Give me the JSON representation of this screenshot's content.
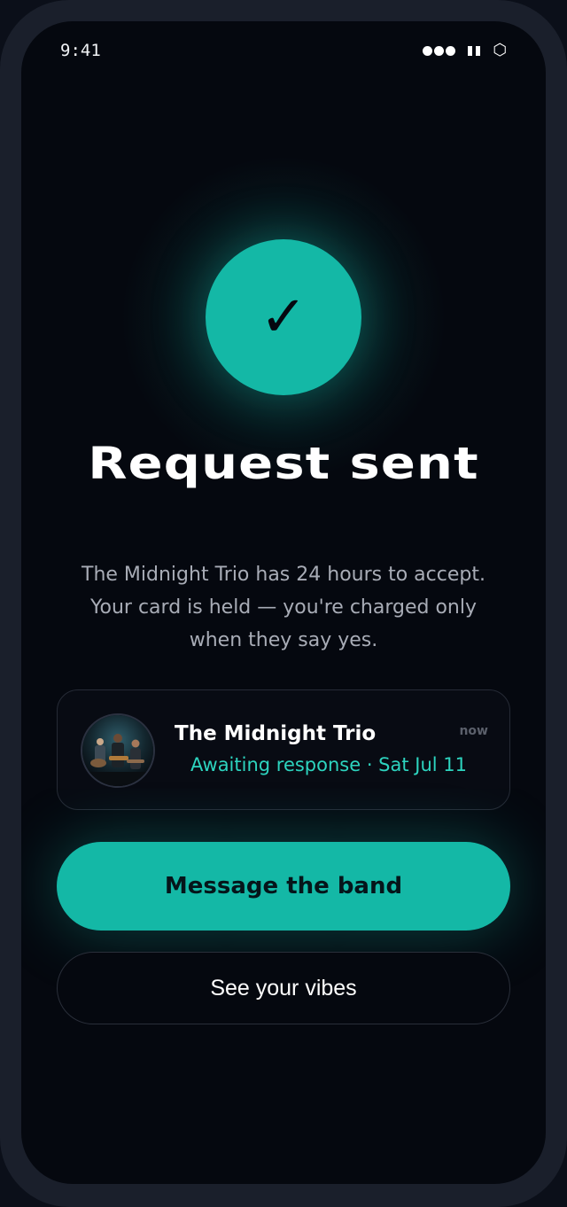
{
  "status_bar": {
    "time": "9:41",
    "icons": [
      "signal-icon",
      "wifi-icon",
      "battery-icon"
    ],
    "battery_glyph": "⬡"
  },
  "hero": {
    "icon": "check-icon",
    "check_glyph": "✓",
    "title": "Request sent",
    "subtitle": "The Midnight Trio has 24 hours to accept. Your card is held — you're charged only when they say yes."
  },
  "band_card": {
    "avatar": "band-photo",
    "name": "The Midnight Trio",
    "status": "Awaiting response · Sat Jul 11",
    "time": "now"
  },
  "actions": {
    "primary_label": "Message the band",
    "secondary_label": "See your vibes"
  },
  "colors": {
    "accent": "#14b8a6",
    "accent_text": "#2dd4bf",
    "background": "#05080f",
    "frame": "#1a1f2b"
  }
}
